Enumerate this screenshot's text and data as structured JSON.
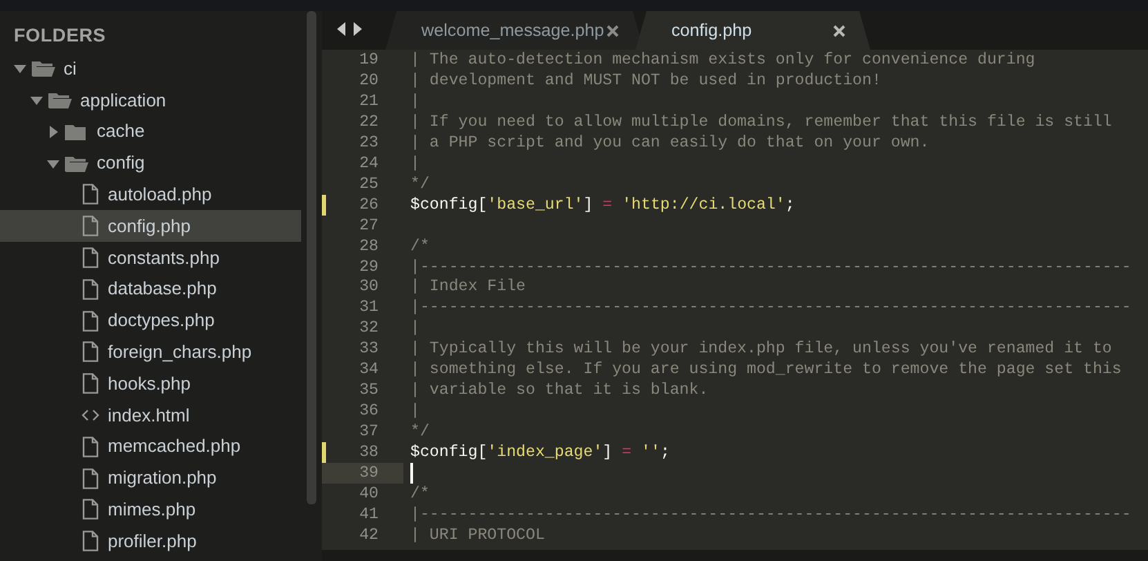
{
  "sidebar": {
    "title": "FOLDERS",
    "tree": [
      {
        "label": "ci",
        "kind": "folder",
        "expanded": true,
        "selected": false,
        "children": [
          {
            "label": "application",
            "kind": "folder",
            "expanded": true,
            "selected": false,
            "children": [
              {
                "label": "cache",
                "kind": "folder",
                "expanded": false,
                "selected": false
              },
              {
                "label": "config",
                "kind": "folder",
                "expanded": true,
                "selected": false,
                "children": [
                  {
                    "label": "autoload.php",
                    "kind": "file",
                    "selected": false
                  },
                  {
                    "label": "config.php",
                    "kind": "file",
                    "selected": true
                  },
                  {
                    "label": "constants.php",
                    "kind": "file",
                    "selected": false
                  },
                  {
                    "label": "database.php",
                    "kind": "file",
                    "selected": false
                  },
                  {
                    "label": "doctypes.php",
                    "kind": "file",
                    "selected": false
                  },
                  {
                    "label": "foreign_chars.php",
                    "kind": "file",
                    "selected": false
                  },
                  {
                    "label": "hooks.php",
                    "kind": "file",
                    "selected": false
                  },
                  {
                    "label": "index.html",
                    "kind": "markup",
                    "selected": false
                  },
                  {
                    "label": "memcached.php",
                    "kind": "file",
                    "selected": false
                  },
                  {
                    "label": "migration.php",
                    "kind": "file",
                    "selected": false
                  },
                  {
                    "label": "mimes.php",
                    "kind": "file",
                    "selected": false
                  },
                  {
                    "label": "profiler.php",
                    "kind": "file",
                    "selected": false
                  }
                ]
              }
            ]
          }
        ]
      }
    ]
  },
  "tabs": [
    {
      "label": "welcome_message.php",
      "selected": false
    },
    {
      "label": "config.php",
      "selected": true
    }
  ],
  "editor": {
    "lines": [
      {
        "number": "19",
        "modified": false,
        "current": false,
        "tokens": [
          {
            "kind": "comment",
            "text": "| The auto-detection mechanism exists only for convenience during"
          }
        ]
      },
      {
        "number": "20",
        "modified": false,
        "current": false,
        "tokens": [
          {
            "kind": "comment",
            "text": "| development and MUST NOT be used in production!"
          }
        ]
      },
      {
        "number": "21",
        "modified": false,
        "current": false,
        "tokens": [
          {
            "kind": "comment",
            "text": "|"
          }
        ]
      },
      {
        "number": "22",
        "modified": false,
        "current": false,
        "tokens": [
          {
            "kind": "comment",
            "text": "| If you need to allow multiple domains, remember that this file is still"
          }
        ]
      },
      {
        "number": "23",
        "modified": false,
        "current": false,
        "tokens": [
          {
            "kind": "comment",
            "text": "| a PHP script and you can easily do that on your own."
          }
        ]
      },
      {
        "number": "24",
        "modified": false,
        "current": false,
        "tokens": [
          {
            "kind": "comment",
            "text": "|"
          }
        ]
      },
      {
        "number": "25",
        "modified": false,
        "current": false,
        "tokens": [
          {
            "kind": "comment",
            "text": "*/"
          }
        ]
      },
      {
        "number": "26",
        "modified": true,
        "current": false,
        "tokens": [
          {
            "kind": "plain",
            "text": "$config["
          },
          {
            "kind": "string",
            "text": "'base_url'"
          },
          {
            "kind": "plain",
            "text": "] "
          },
          {
            "kind": "operator",
            "text": "= "
          },
          {
            "kind": "string",
            "text": "'http://ci.local'"
          },
          {
            "kind": "plain",
            "text": ";"
          }
        ]
      },
      {
        "number": "27",
        "modified": false,
        "current": false
      },
      {
        "number": "28",
        "modified": false,
        "current": false,
        "tokens": [
          {
            "kind": "comment",
            "text": "/*"
          }
        ]
      },
      {
        "number": "29",
        "modified": false,
        "current": false,
        "tokens": [
          {
            "kind": "comment",
            "text": "|--------------------------------------------------------------------------"
          }
        ]
      },
      {
        "number": "30",
        "modified": false,
        "current": false,
        "tokens": [
          {
            "kind": "comment",
            "text": "| Index File"
          }
        ]
      },
      {
        "number": "31",
        "modified": false,
        "current": false,
        "tokens": [
          {
            "kind": "comment",
            "text": "|--------------------------------------------------------------------------"
          }
        ]
      },
      {
        "number": "32",
        "modified": false,
        "current": false,
        "tokens": [
          {
            "kind": "comment",
            "text": "|"
          }
        ]
      },
      {
        "number": "33",
        "modified": false,
        "current": false,
        "tokens": [
          {
            "kind": "comment",
            "text": "| Typically this will be your index.php file, unless you've renamed it to"
          }
        ]
      },
      {
        "number": "34",
        "modified": false,
        "current": false,
        "tokens": [
          {
            "kind": "comment",
            "text": "| something else. If you are using mod_rewrite to remove the page set this"
          }
        ]
      },
      {
        "number": "35",
        "modified": false,
        "current": false,
        "tokens": [
          {
            "kind": "comment",
            "text": "| variable so that it is blank."
          }
        ]
      },
      {
        "number": "36",
        "modified": false,
        "current": false,
        "tokens": [
          {
            "kind": "comment",
            "text": "|"
          }
        ]
      },
      {
        "number": "37",
        "modified": false,
        "current": false,
        "tokens": [
          {
            "kind": "comment",
            "text": "*/"
          }
        ]
      },
      {
        "number": "38",
        "modified": true,
        "current": false,
        "tokens": [
          {
            "kind": "plain",
            "text": "$config["
          },
          {
            "kind": "string",
            "text": "'index_page'"
          },
          {
            "kind": "plain",
            "text": "] "
          },
          {
            "kind": "operator",
            "text": "= "
          },
          {
            "kind": "string",
            "text": "''"
          },
          {
            "kind": "plain",
            "text": ";"
          }
        ]
      },
      {
        "number": "39",
        "modified": false,
        "current": true
      },
      {
        "number": "40",
        "modified": false,
        "current": false,
        "tokens": [
          {
            "kind": "comment",
            "text": "/*"
          }
        ]
      },
      {
        "number": "41",
        "modified": false,
        "current": false,
        "tokens": [
          {
            "kind": "comment",
            "text": "|--------------------------------------------------------------------------"
          }
        ]
      },
      {
        "number": "42",
        "modified": false,
        "current": false,
        "tokens": [
          {
            "kind": "comment",
            "text": "| URI PROTOCOL"
          }
        ]
      }
    ]
  }
}
